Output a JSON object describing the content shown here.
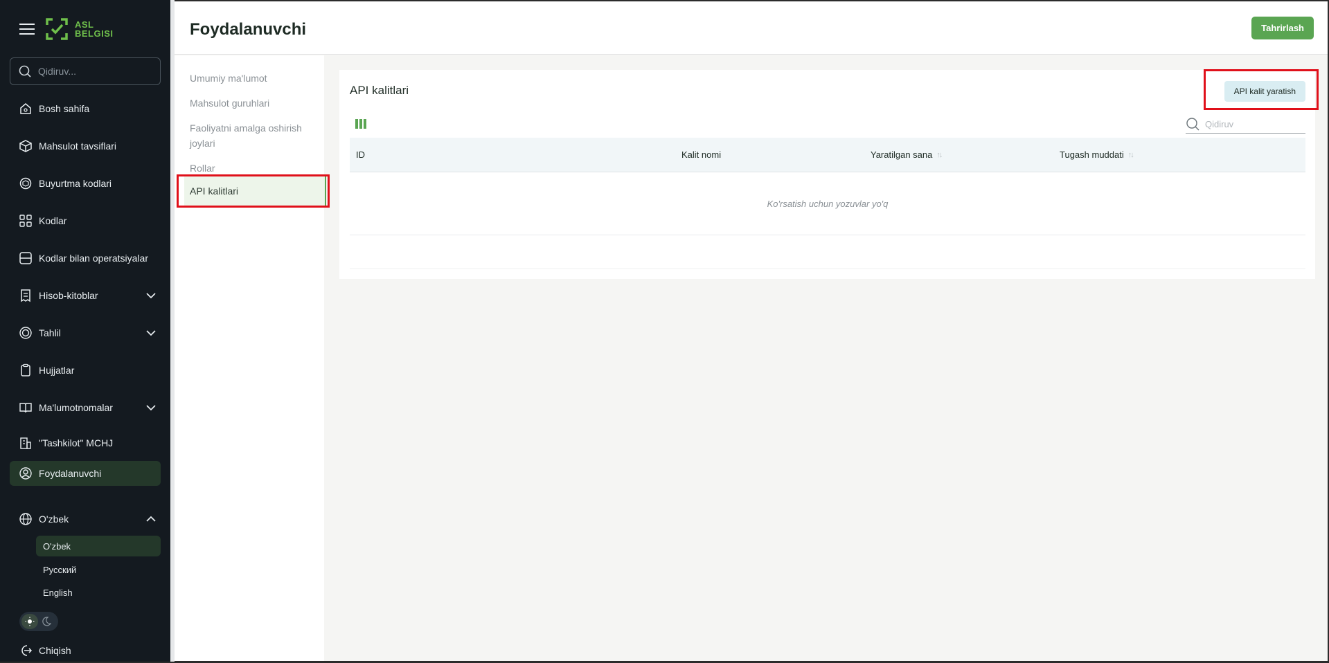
{
  "app": {
    "logo_line1": "ASL",
    "logo_line2": "BELGISI"
  },
  "sidebar": {
    "search_placeholder": "Qidiruv...",
    "items": [
      {
        "label": "Bosh sahifa"
      },
      {
        "label": "Mahsulot tavsiflari"
      },
      {
        "label": "Buyurtma kodlari"
      },
      {
        "label": "Kodlar"
      },
      {
        "label": "Kodlar bilan operatsiyalar"
      },
      {
        "label": "Hisob-kitoblar"
      },
      {
        "label": "Tahlil"
      },
      {
        "label": "Hujjatlar"
      },
      {
        "label": "Ma'lumotnomalar"
      },
      {
        "label": "\"Tashkilot\" MCHJ"
      },
      {
        "label": "Foydalanuvchi"
      }
    ],
    "language": {
      "label": "O'zbek",
      "options": [
        "O'zbek",
        "Русский",
        "English"
      ]
    },
    "logout": "Chiqish"
  },
  "header": {
    "title": "Foydalanuvchi",
    "edit_label": "Tahrirlash"
  },
  "subnav": {
    "items": [
      {
        "label": "Umumiy ma'lumot"
      },
      {
        "label": "Mahsulot guruhlari"
      },
      {
        "label": "Faoliyatni amalga oshirish joylari"
      },
      {
        "label": "Rollar"
      },
      {
        "label": "API kalitlari"
      }
    ]
  },
  "card": {
    "title": "API kalitlari",
    "create_label": "API kalit yaratish",
    "search_placeholder": "Qidiruv",
    "columns": [
      "ID",
      "Kalit nomi",
      "Yaratilgan sana",
      "Tugash muddati"
    ],
    "empty_text": "Ko'rsatish uchun yozuvlar yo'q"
  },
  "colors": {
    "accent": "#5aa552",
    "sidebar_bg": "#141a20",
    "active_bg": "#24382a",
    "highlight_red": "#e0101a"
  }
}
